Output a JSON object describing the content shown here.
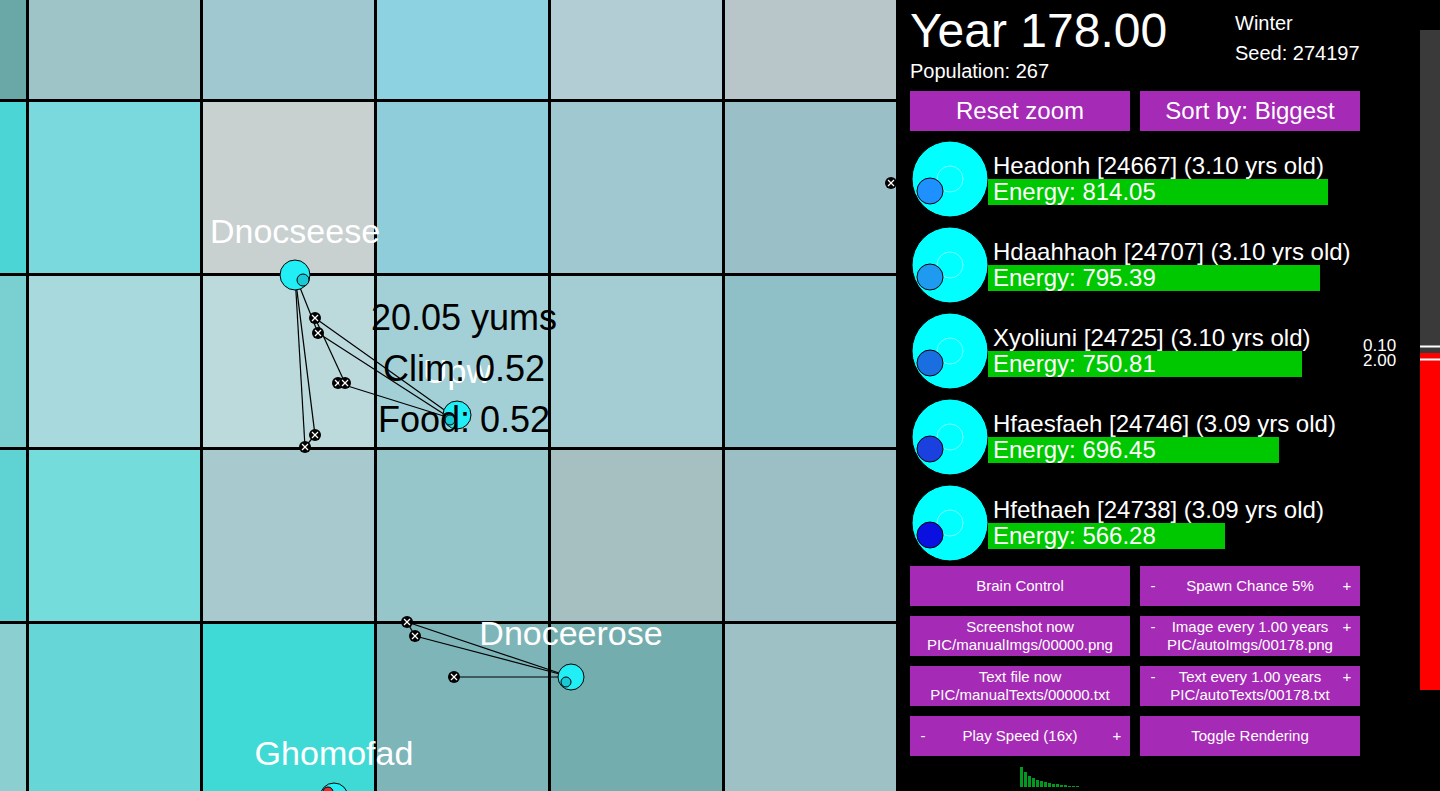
{
  "map": {
    "tiles": [
      [
        "#6aa8a8",
        "#9fc4c8",
        "#a0c8d0",
        "#8dd2e0",
        "#b3cdd4",
        "#b8c6ca"
      ],
      [
        "#4cd5d5",
        "#7ad9dc",
        "#c8d0d0",
        "#8ecdd9",
        "#9fc8d0",
        "#9abfc6"
      ],
      [
        "#7acfd0",
        "#a8dadd",
        "#bcd9dc",
        "#a3d0d6",
        "#a3cdd3",
        "#8fc0c7"
      ],
      [
        "#5fd3d3",
        "#75dcdc",
        "#a8cace",
        "#96c5ca",
        "#a6bfc1",
        "#9bbfc4"
      ],
      [
        "#8ccfd0",
        "#66d6d6",
        "#40dad6",
        "#7db5b8",
        "#74adad",
        "#9ec1c5"
      ]
    ],
    "creatures": [
      {
        "kind": "creature",
        "name": "Dnocseese",
        "mouth_color": "#19c9d6"
      },
      {
        "kind": "creature",
        "name": "Upw",
        "mouth_color": "#19c9d6"
      },
      {
        "kind": "creature",
        "name": "Dnoceerose",
        "mouth_color": "#19c9d6"
      },
      {
        "kind": "creature",
        "name": "Ghomofad",
        "mouth_color": "#e03030"
      },
      {
        "kind": "offscreen",
        "name": "",
        "mouth_color": "#19c9d6"
      }
    ],
    "tile_info": [
      "20.05 yums",
      "Clim: 0.52",
      "Food: 0.52"
    ]
  },
  "header": {
    "year": "Year 178.00",
    "population": "Population: 267",
    "season": "Winter",
    "seed": "Seed: 274197"
  },
  "top_buttons": [
    "Reset zoom",
    "Sort by: Biggest"
  ],
  "leaderboard": [
    {
      "name": "Headonh [24667] (3.10 yrs old)",
      "energy": "Energy: 814.05",
      "level": 0.814,
      "mouth_color": "#1e90ff"
    },
    {
      "name": "Hdaahhaoh [24707] (3.10 yrs old)",
      "energy": "Energy: 795.39",
      "level": 0.795,
      "mouth_color": "#1e9af0"
    },
    {
      "name": "Xyoliuni [24725] (3.10 yrs old)",
      "energy": "Energy: 750.81",
      "level": 0.751,
      "mouth_color": "#1a6fe0"
    },
    {
      "name": "Hfaesfaeh [24746] (3.09 yrs old)",
      "energy": "Energy: 696.45",
      "level": 0.696,
      "mouth_color": "#1a40e0"
    },
    {
      "name": "Hfethaeh [24738] (3.09 yrs old)",
      "energy": "Energy: 566.28",
      "level": 0.566,
      "mouth_color": "#0a10e0"
    }
  ],
  "controls": [
    {
      "kind": "button",
      "label": "Brain Control",
      "path": "",
      "minus": "",
      "plus": ""
    },
    {
      "kind": "stepper",
      "label": "Spawn Chance 5%",
      "path": "",
      "minus": "-",
      "plus": "+"
    },
    {
      "kind": "button",
      "label": "Screenshot now",
      "path": "PIC/manualImgs/00000.png",
      "minus": "",
      "plus": ""
    },
    {
      "kind": "stepper",
      "label": "Image every 1.00 years",
      "path": "PIC/autoImgs/00178.png",
      "minus": "-",
      "plus": "+"
    },
    {
      "kind": "button",
      "label": "Text file now",
      "path": "PIC/manualTexts/00000.txt",
      "minus": "",
      "plus": ""
    },
    {
      "kind": "stepper",
      "label": "Text every 1.00 years",
      "path": "PIC/autoTexts/00178.txt",
      "minus": "-",
      "plus": "+"
    },
    {
      "kind": "stepper",
      "label": "Play Speed (16x)",
      "path": "",
      "minus": "-",
      "plus": "+"
    },
    {
      "kind": "button",
      "label": "Toggle Rendering",
      "path": "",
      "minus": "",
      "plus": ""
    }
  ],
  "slider": {
    "labels": [
      "0.10",
      "2.00"
    ],
    "level": 0.51
  },
  "histogram": [
    20,
    15,
    11,
    9,
    7,
    6,
    5,
    4,
    3,
    3,
    2,
    2,
    1,
    1,
    1
  ]
}
